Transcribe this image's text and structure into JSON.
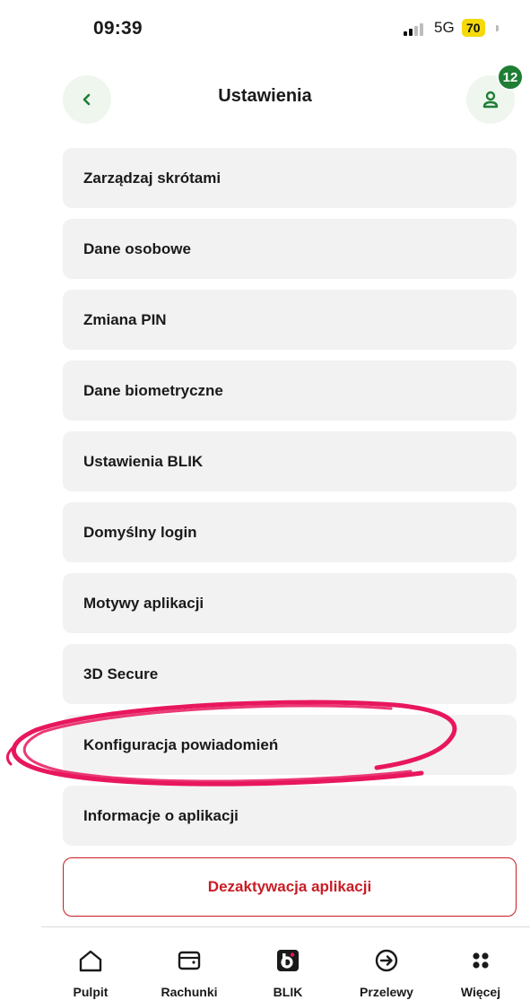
{
  "status_bar": {
    "time": "09:39",
    "network": "5G",
    "battery": "70"
  },
  "header": {
    "title": "Ustawienia",
    "notification_count": "12"
  },
  "menu": {
    "items": [
      {
        "label": "Zarządzaj skrótami"
      },
      {
        "label": "Dane osobowe"
      },
      {
        "label": "Zmiana PIN"
      },
      {
        "label": "Dane biometryczne"
      },
      {
        "label": "Ustawienia BLIK"
      },
      {
        "label": "Domyślny login"
      },
      {
        "label": "Motywy aplikacji"
      },
      {
        "label": "3D Secure"
      },
      {
        "label": "Konfiguracja powiadomień"
      },
      {
        "label": "Informacje o aplikacji"
      }
    ],
    "deactivate_label": "Dezaktywacja aplikacji"
  },
  "bottom_nav": {
    "items": [
      {
        "label": "Pulpit",
        "icon": "home-icon"
      },
      {
        "label": "Rachunki",
        "icon": "wallet-icon"
      },
      {
        "label": "BLIK",
        "icon": "blik-icon"
      },
      {
        "label": "Przelewy",
        "icon": "transfer-icon"
      },
      {
        "label": "Więcej",
        "icon": "more-icon"
      }
    ]
  },
  "colors": {
    "accent_green": "#1e7e34",
    "danger_red": "#c81d25",
    "annotation_pink": "#e8175d",
    "battery_yellow": "#f5d90a"
  }
}
